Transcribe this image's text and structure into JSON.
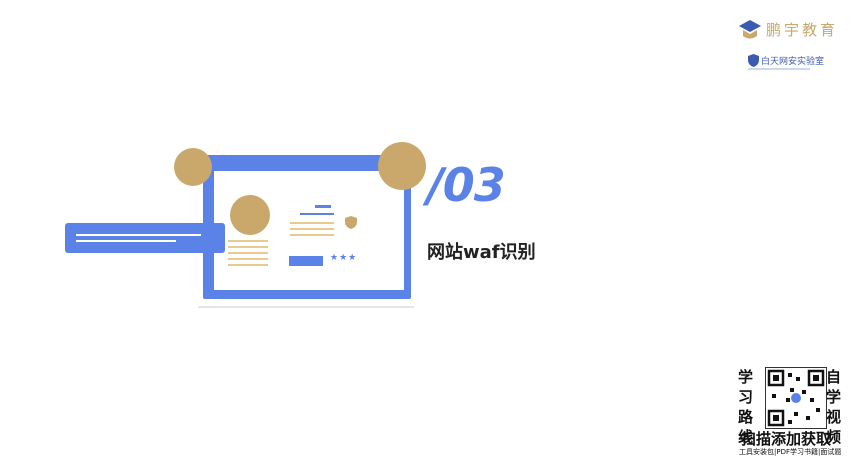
{
  "branding": {
    "logo_text": "鹏宇教育",
    "sub_logo_text": "白天网安实验室"
  },
  "slide": {
    "number": "/03",
    "title": "网站waf识别"
  },
  "illustration": {
    "rating_stars": "★★★"
  },
  "promo": {
    "left_text": [
      "学",
      "习",
      "路",
      "线"
    ],
    "right_text": [
      "自",
      "学",
      "视",
      "频"
    ],
    "cta": "扫描添加获取",
    "tags": "工具安装包|PDF学习书籍|面试题"
  },
  "colors": {
    "accent_blue": "#5b82e6",
    "gold": "#caa86c"
  }
}
